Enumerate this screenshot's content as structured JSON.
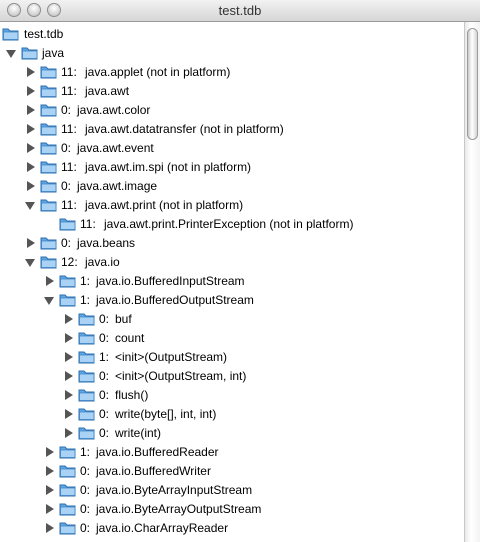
{
  "window": {
    "title": "test.tdb"
  },
  "tree": {
    "root": "test.tdb",
    "java": "java",
    "rows": [
      {
        "count": "11",
        "name": "java.applet (not in platform)"
      },
      {
        "count": "11",
        "name": "java.awt"
      },
      {
        "count": "0",
        "name": "java.awt.color"
      },
      {
        "count": "11",
        "name": "java.awt.datatransfer (not in platform)"
      },
      {
        "count": "0",
        "name": "java.awt.event"
      },
      {
        "count": "11",
        "name": "java.awt.im.spi (not in platform)"
      },
      {
        "count": "0",
        "name": "java.awt.image"
      },
      {
        "count": "11",
        "name": "java.awt.print (not in platform)"
      },
      {
        "count": "11",
        "name": "java.awt.print.PrinterException (not in platform)"
      },
      {
        "count": "0",
        "name": "java.beans"
      },
      {
        "count": "12",
        "name": "java.io"
      },
      {
        "count": "1",
        "name": "java.io.BufferedInputStream"
      },
      {
        "count": "1",
        "name": "java.io.BufferedOutputStream"
      },
      {
        "count": "0",
        "name": "buf"
      },
      {
        "count": "0",
        "name": "count"
      },
      {
        "count": "1",
        "name": "<init>(OutputStream)"
      },
      {
        "count": "0",
        "name": "<init>(OutputStream, int)"
      },
      {
        "count": "0",
        "name": "flush()"
      },
      {
        "count": "0",
        "name": "write(byte[], int, int)"
      },
      {
        "count": "0",
        "name": "write(int)"
      },
      {
        "count": "1",
        "name": "java.io.BufferedReader"
      },
      {
        "count": "0",
        "name": "java.io.BufferedWriter"
      },
      {
        "count": "0",
        "name": "java.io.ByteArrayInputStream"
      },
      {
        "count": "0",
        "name": "java.io.ByteArrayOutputStream"
      },
      {
        "count": "0",
        "name": "java.io.CharArrayReader"
      }
    ]
  }
}
